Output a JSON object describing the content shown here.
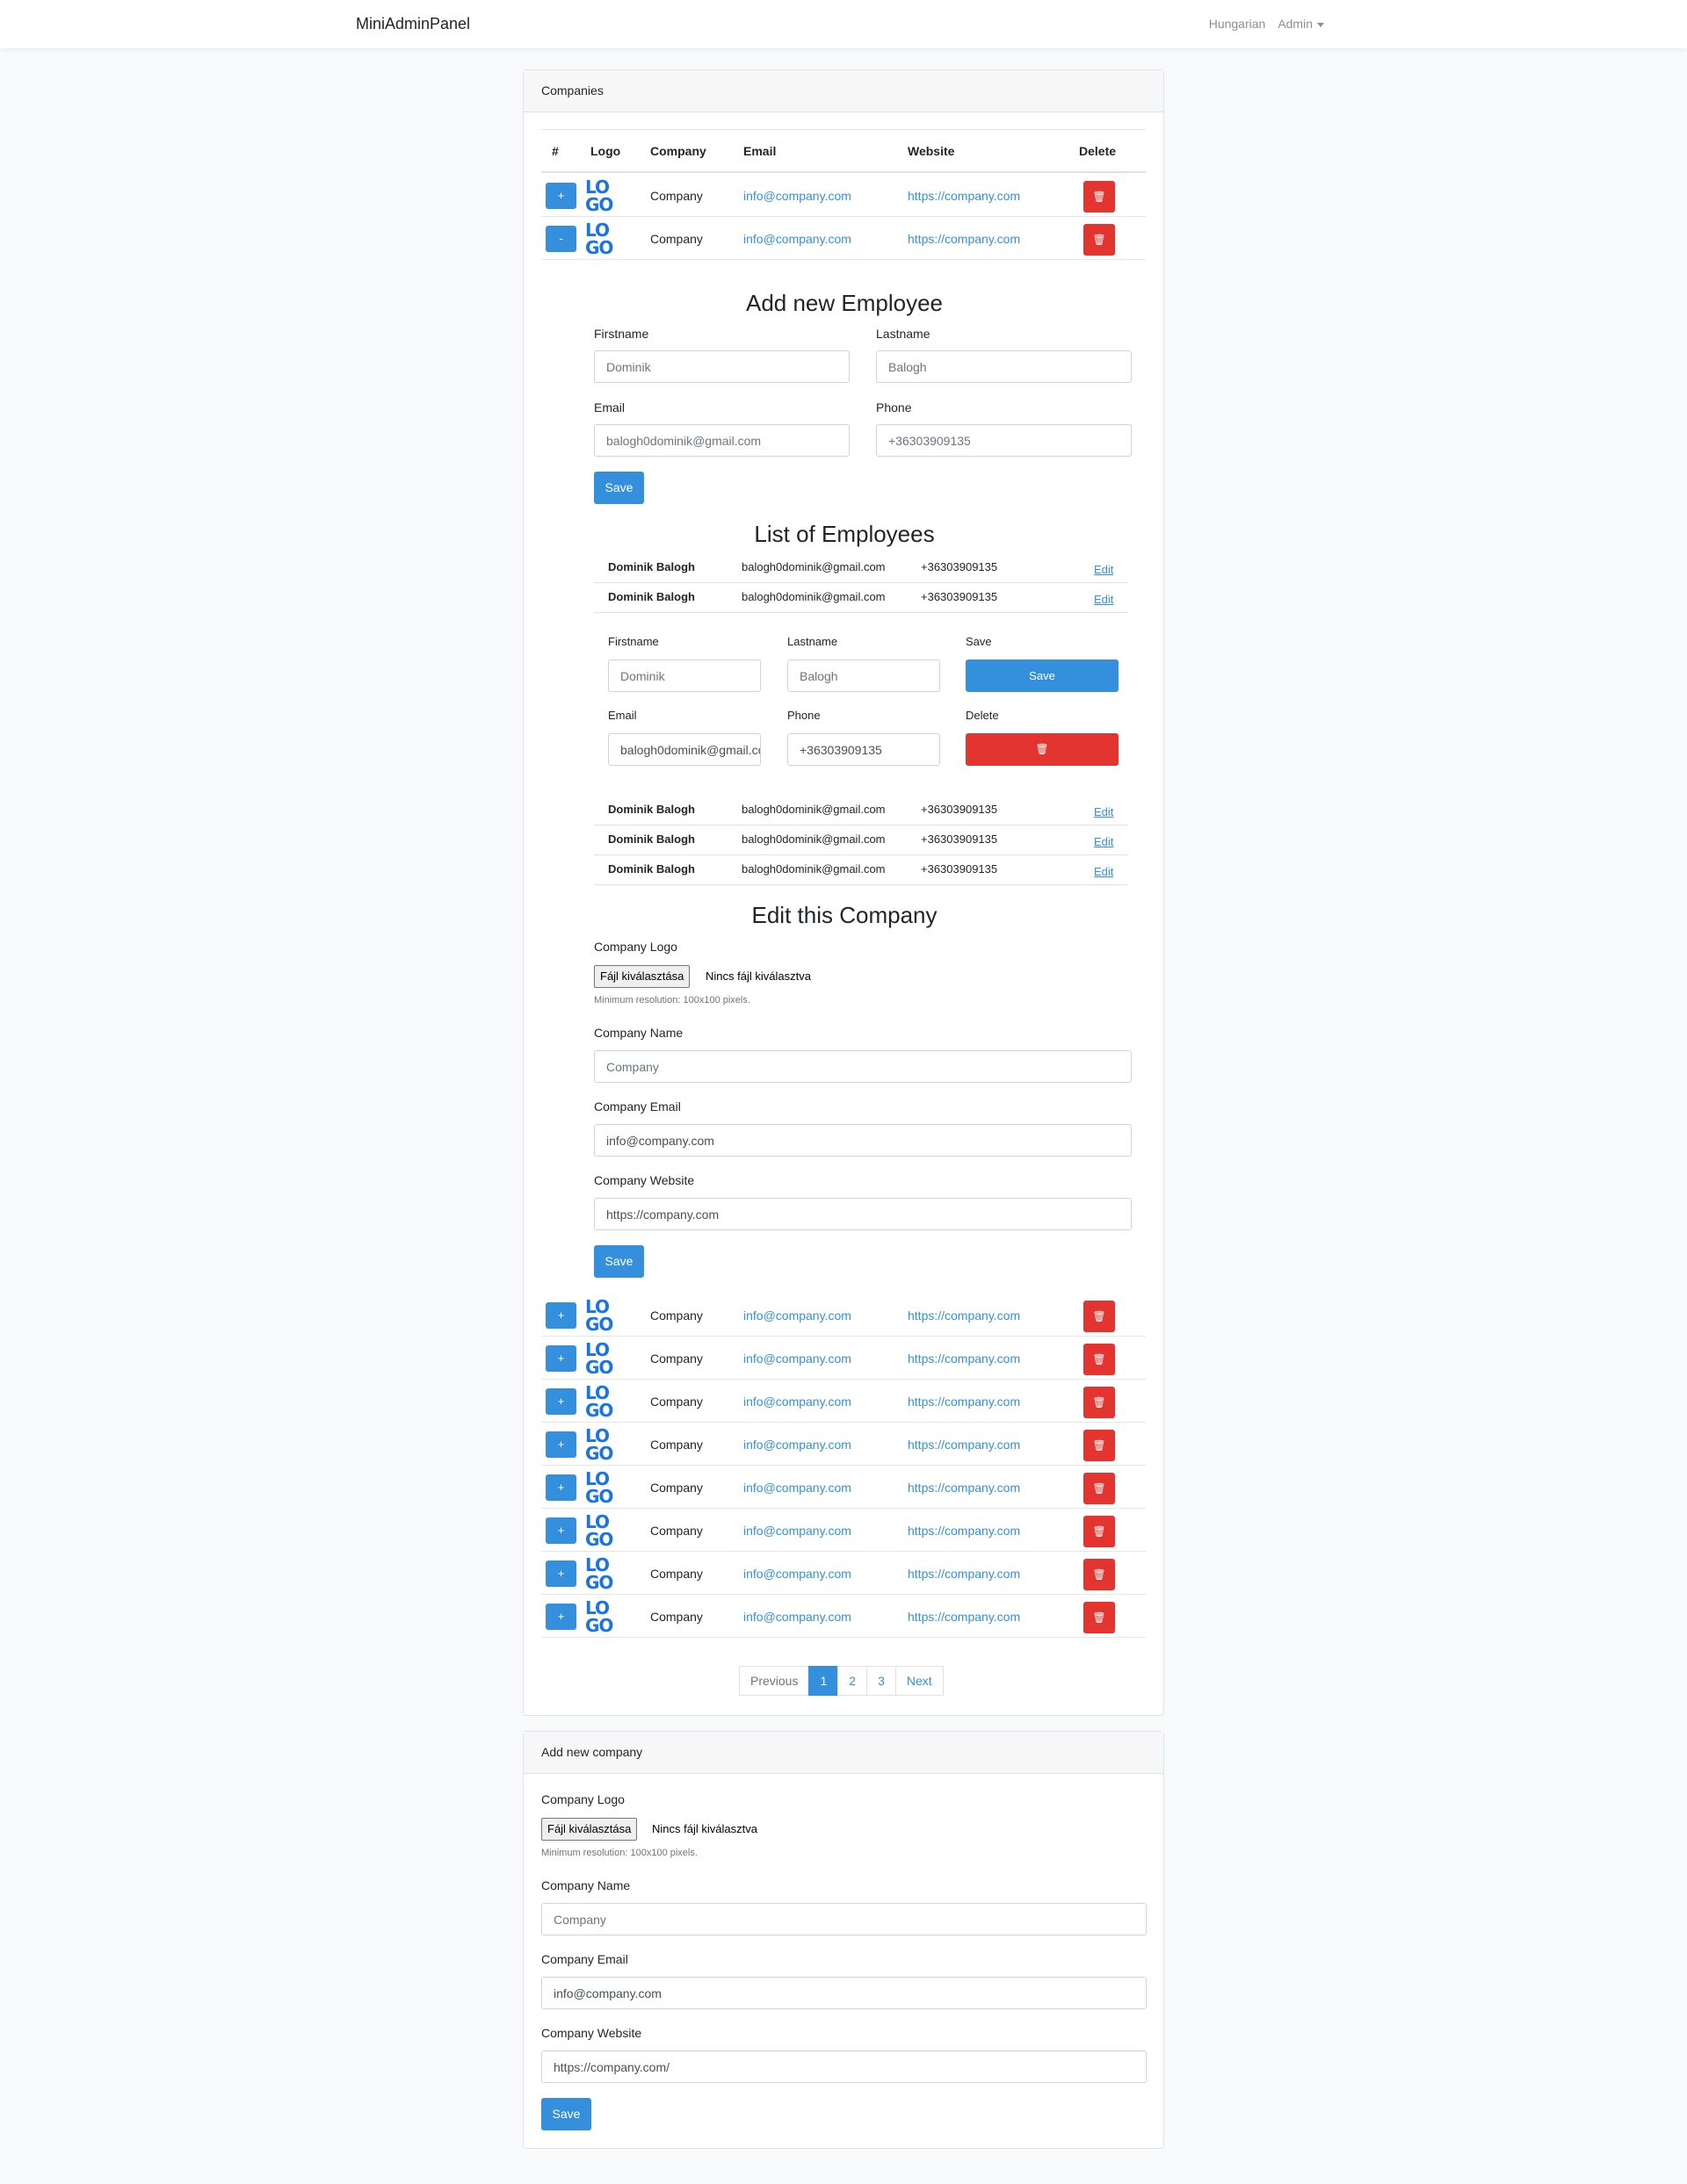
{
  "navbar": {
    "brand": "MiniAdminPanel",
    "language": "Hungarian",
    "user": "Admin"
  },
  "companies": {
    "header": "Companies",
    "columns": [
      "#",
      "Logo",
      "Company",
      "Email",
      "Website",
      "Delete"
    ],
    "logo_text": [
      "LO",
      "GO"
    ],
    "rows_top": [
      {
        "toggle": "+",
        "company": "Company",
        "email": "info@company.com",
        "website": "https://company.com"
      },
      {
        "toggle": "-",
        "company": "Company",
        "email": "info@company.com",
        "website": "https://company.com"
      }
    ],
    "rows_bottom": [
      {
        "toggle": "+",
        "company": "Company",
        "email": "info@company.com",
        "website": "https://company.com"
      },
      {
        "toggle": "+",
        "company": "Company",
        "email": "info@company.com",
        "website": "https://company.com"
      },
      {
        "toggle": "+",
        "company": "Company",
        "email": "info@company.com",
        "website": "https://company.com"
      },
      {
        "toggle": "+",
        "company": "Company",
        "email": "info@company.com",
        "website": "https://company.com"
      },
      {
        "toggle": "+",
        "company": "Company",
        "email": "info@company.com",
        "website": "https://company.com"
      },
      {
        "toggle": "+",
        "company": "Company",
        "email": "info@company.com",
        "website": "https://company.com"
      },
      {
        "toggle": "+",
        "company": "Company",
        "email": "info@company.com",
        "website": "https://company.com"
      },
      {
        "toggle": "+",
        "company": "Company",
        "email": "info@company.com",
        "website": "https://company.com"
      }
    ],
    "delete_icon": "trash-icon"
  },
  "add_employee": {
    "title": "Add new Employee",
    "firstname_label": "Firstname",
    "firstname_placeholder": "Dominik",
    "lastname_label": "Lastname",
    "lastname_placeholder": "Balogh",
    "email_label": "Email",
    "email_placeholder": "balogh0dominik@gmail.com",
    "phone_label": "Phone",
    "phone_placeholder": "+36303909135",
    "save": "Save"
  },
  "employees": {
    "title": "List of Employees",
    "edit_label": "Edit",
    "rows": [
      {
        "name": "Dominik Balogh",
        "email": "balogh0dominik@gmail.com",
        "phone": "+36303909135"
      },
      {
        "name": "Dominik Balogh",
        "email": "balogh0dominik@gmail.com",
        "phone": "+36303909135"
      },
      {
        "name": "Dominik Balogh",
        "email": "balogh0dominik@gmail.com",
        "phone": "+36303909135"
      },
      {
        "name": "Dominik Balogh",
        "email": "balogh0dominik@gmail.com",
        "phone": "+36303909135"
      },
      {
        "name": "Dominik Balogh",
        "email": "balogh0dominik@gmail.com",
        "phone": "+36303909135"
      }
    ],
    "edit_form": {
      "firstname_label": "Firstname",
      "firstname_value": "Dominik",
      "lastname_label": "Lastname",
      "lastname_value": "Balogh",
      "save_label": "Save",
      "save_button": "Save",
      "email_label": "Email",
      "email_value": "balogh0dominik@gmail.com",
      "phone_label": "Phone",
      "phone_value": "+36303909135",
      "delete_label": "Delete"
    }
  },
  "edit_company": {
    "title": "Edit this Company",
    "logo_label": "Company Logo",
    "file_button": "Fájl kiválasztása",
    "file_status": "Nincs fájl kiválasztva",
    "hint": "Minimum resolution: 100x100 pixels.",
    "name_label": "Company Name",
    "name_placeholder": "Company",
    "email_label": "Company Email",
    "email_placeholder": "info@company.com",
    "website_label": "Company Website",
    "website_placeholder": "https://company.com",
    "save": "Save"
  },
  "pagination": {
    "previous": "Previous",
    "pages": [
      "1",
      "2",
      "3"
    ],
    "next": "Next",
    "active": "1"
  },
  "add_company": {
    "header": "Add new company",
    "logo_label": "Company Logo",
    "file_button": "Fájl kiválasztása",
    "file_status": "Nincs fájl kiválasztva",
    "hint": "Minimum resolution: 100x100 pixels.",
    "name_label": "Company Name",
    "name_placeholder": "Company",
    "email_label": "Company Email",
    "email_placeholder": "info@company.com",
    "website_label": "Company Website",
    "website_placeholder": "https://company.com/",
    "save": "Save"
  },
  "colors": {
    "primary": "#3490dc",
    "danger": "#e3342f",
    "logo": "#1a73e8"
  }
}
